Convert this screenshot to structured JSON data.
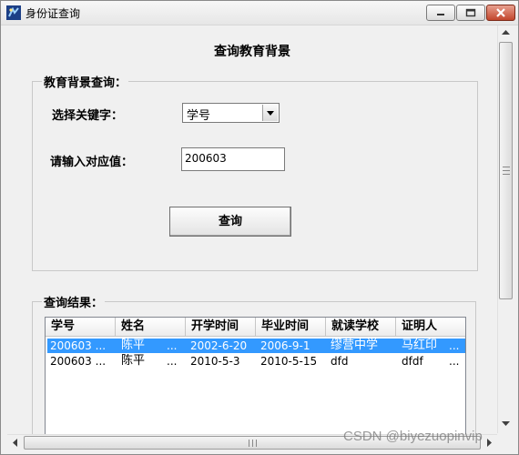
{
  "window": {
    "title": "身份证查询",
    "app_icon": "app-icon",
    "controls": {
      "minimize": "minimize-icon",
      "maximize": "maximize-icon",
      "close": "close-icon"
    }
  },
  "heading": "查询教育背景",
  "search_group": {
    "legend": "教育背景查询：",
    "keyword_label": "选择关键字：",
    "keyword_value": "学号",
    "value_label": "请输入对应值：",
    "value_input": "200603",
    "query_button": "查询"
  },
  "results_group": {
    "legend": "查询结果：",
    "columns": [
      "学号",
      "姓名",
      "开学时间",
      "毕业时间",
      "就读学校",
      "证明人"
    ],
    "rows": [
      {
        "cells": [
          "200603 ...",
          "陈平",
          "2002-6-20",
          "2006-9-1",
          "缪营中学",
          "马红印"
        ],
        "name_ellipsis": "...",
        "last_ellipsis": "...",
        "selected": true
      },
      {
        "cells": [
          "200603 ...",
          "陈平",
          "2010-5-3",
          "2010-5-15",
          "dfd",
          "dfdf"
        ],
        "name_ellipsis": "...",
        "last_ellipsis": "...",
        "selected": false
      }
    ]
  },
  "watermark": "CSDN @biyezuopinvip",
  "colors": {
    "selection": "#3399ff",
    "titlebar": "#e6e6e6",
    "close_button": "#c2462c"
  }
}
